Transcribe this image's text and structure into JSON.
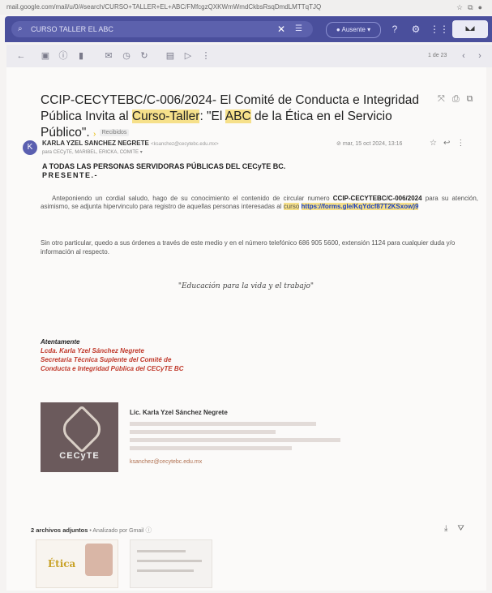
{
  "url": "mail.google.com/mail/u/0/#search/CURSO+TALLER+EL+ABC/FMfcgzQXKWmWmdCkbsRsqDmdLMTTqTJQ",
  "search": {
    "placeholder": "CURSO TALLER EL ABC"
  },
  "status": {
    "label": "Ausente"
  },
  "toolbar": {
    "count": "1 de 23"
  },
  "email": {
    "subject_part1": "CCIP-CECYTEBC/C-006/2024- El Comité de Conducta e Integridad Pública Invita al ",
    "subject_part2": "Curso-Taller",
    "subject_part3": ": \"El ",
    "subject_part4": "ABC",
    "subject_part5": " de la Ética en el Servicio Público\".",
    "label": "Recibidos",
    "avatar_letter": "K",
    "sender_name": "KARLA YZEL SANCHEZ NEGRETE",
    "sender_email": "<ksanchez@cecytebc.edu.mx>",
    "to": "para CECyTE, MARIBEL, ERICKA, COMITE",
    "date": "mar, 15 oct 2024, 13:16",
    "greeting_1": "A TODAS LAS PERSONAS SERVIDORAS PÚBLICAS DEL CECyTE BC.",
    "greeting_2": "PRESENTE.-",
    "body_1a": "Anteponiendo un cordial saludo, hago de su conocimiento el contenido de circular numero ",
    "body_1b": "CCIP-CECYTEBC/C-006/2024",
    "body_1c": " para su atención, asimismo, se adjunta  hipervinculo para registro de aquellas personas interesadas al ",
    "body_1d": "curso",
    "body_1e": " ",
    "link": "https://forms.gle/KqYdcf87T2KSxow)9",
    "body_2": "Sin otro particular, quedo a sus órdenes a través de este medio y en el número telefónico 686 905 5600, extensión 1124 para cualquier duda y/o información al respecto.",
    "motto": "\"Educación para la vida y el trabajo\"",
    "sig_1": "Atentamente",
    "sig_2": "Lcda. Karla Yzel Sánchez Negrete",
    "sig_3": "Secretaria Técnica Suplente del Comité de",
    "sig_4": "Conducta e Integridad Pública del CECyTE BC",
    "logo_text": "CECyTE",
    "card_name": "Lic. Karla Yzel Sánchez Negrete",
    "card_email": "ksanchez@cecytebc.edu.mx",
    "attachments_title": "2 archivos adjuntos",
    "attachments_sub": " • Analizado por Gmail",
    "attachment_1_text": "Ética"
  }
}
